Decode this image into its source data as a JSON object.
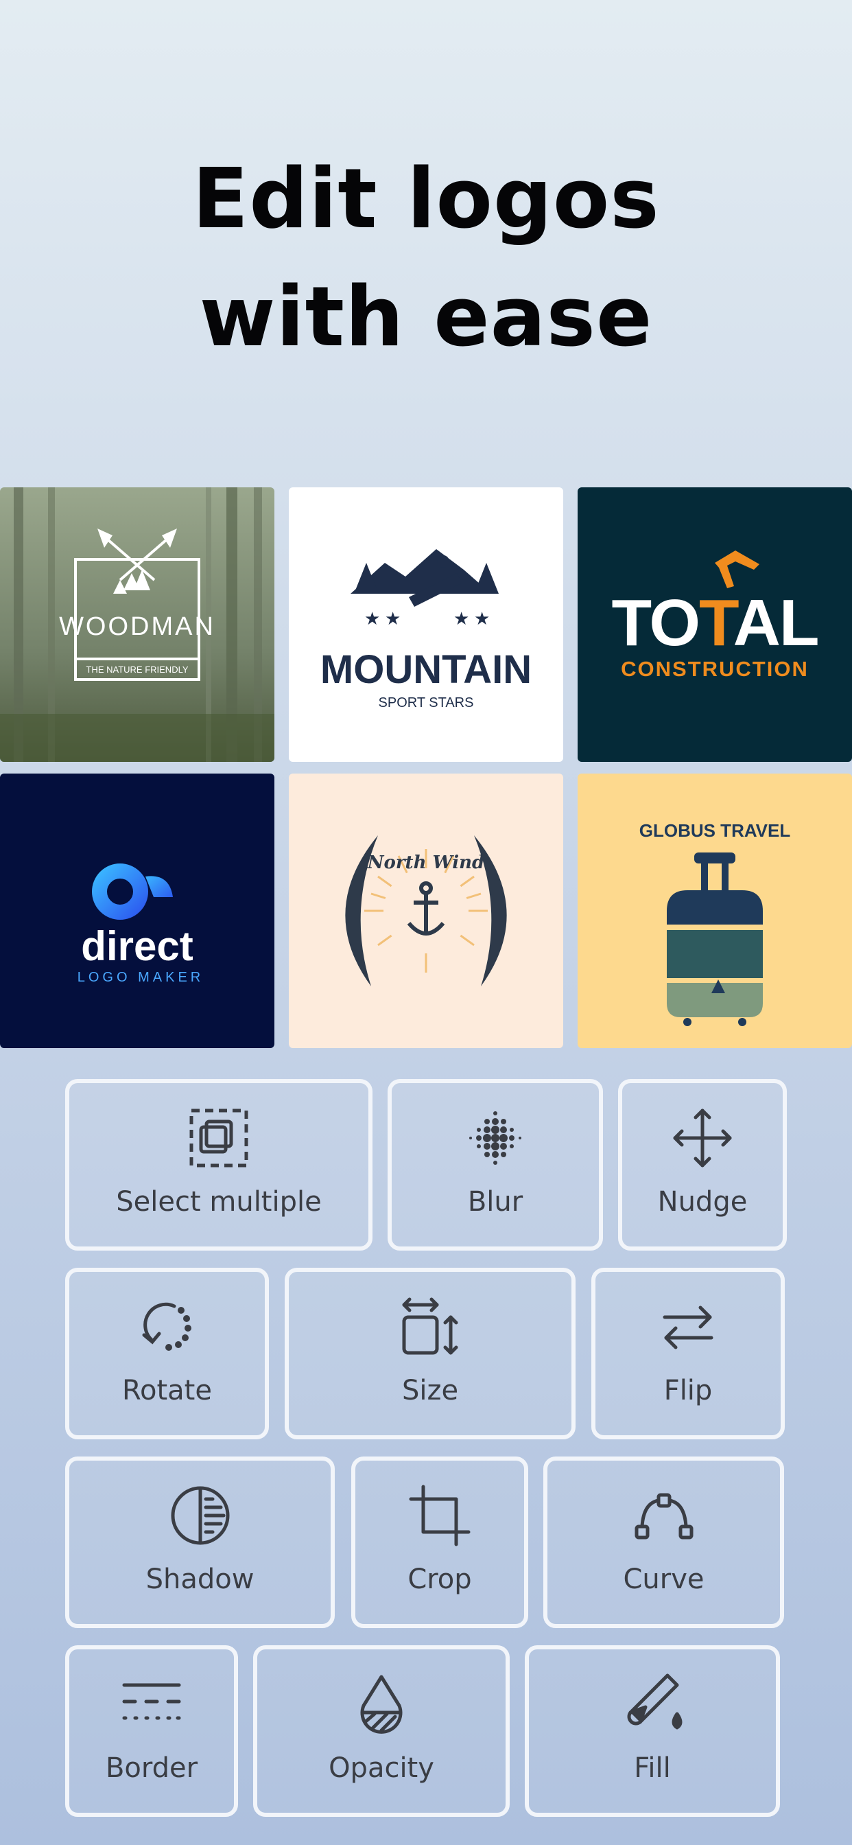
{
  "headline": {
    "line1": "Edit logos",
    "line2": "with ease"
  },
  "logos": [
    {
      "name": "WOODMAN",
      "tagline": "THE NATURE FRIENDLY",
      "bg": "#7d8b70"
    },
    {
      "name": "MOUNTAIN",
      "tagline": "SPORT STARS",
      "bg": "#ffffff"
    },
    {
      "name_part1": "TO",
      "name_part2": "T",
      "name_part3": "AL",
      "tagline": "CONSTRUCTION",
      "bg": "#052a38"
    },
    {
      "name": "direct",
      "tagline": "LOGO MAKER",
      "bg": "#040f3d"
    },
    {
      "name": "North Wind",
      "bg": "#fdebdc"
    },
    {
      "name": "GLOBUS TRAVEL",
      "bg": "#fdd98e"
    }
  ],
  "tools": [
    {
      "label": "Select multiple",
      "icon": "select-multiple-icon"
    },
    {
      "label": "Blur",
      "icon": "blur-icon"
    },
    {
      "label": "Nudge",
      "icon": "nudge-icon"
    },
    {
      "label": "Rotate",
      "icon": "rotate-icon"
    },
    {
      "label": "Size",
      "icon": "size-icon"
    },
    {
      "label": "Flip",
      "icon": "flip-icon"
    },
    {
      "label": "Shadow",
      "icon": "shadow-icon"
    },
    {
      "label": "Crop",
      "icon": "crop-icon"
    },
    {
      "label": "Curve",
      "icon": "curve-icon"
    },
    {
      "label": "Border",
      "icon": "border-icon"
    },
    {
      "label": "Opacity",
      "icon": "opacity-icon"
    },
    {
      "label": "Fill",
      "icon": "fill-icon"
    }
  ],
  "colors": {
    "accent_orange": "#f08c1e",
    "navy": "#1f2e4a",
    "icon_gray": "#3a3d44"
  }
}
